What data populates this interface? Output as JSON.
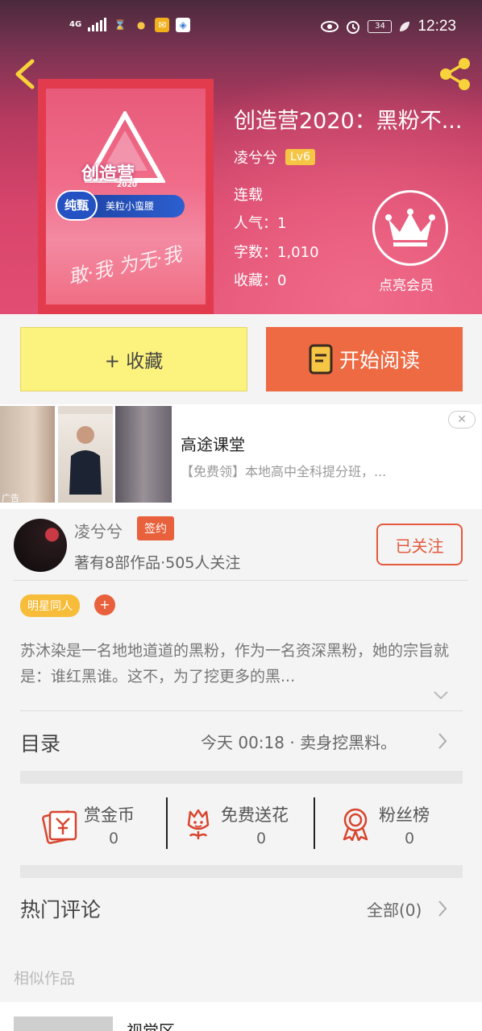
{
  "status_bar": {
    "network": "4G",
    "battery": "34",
    "time": "12:23"
  },
  "book": {
    "title": "创造营2020：黑粉不...",
    "author": "凌兮兮",
    "level": "Lv6",
    "status": "连载",
    "popularity": "人气：1",
    "word_count": "字数：1,010",
    "favorites": "收藏：0",
    "vip_label": "点亮会员",
    "cover": {
      "logo_text": "创造营",
      "logo_year": "2020",
      "sponsor_pill": "纯甄",
      "sponsor_band": "美粒小蛮腰",
      "slogan": "敢·我 为无·我"
    }
  },
  "actions": {
    "favorite_label": "+ 收藏",
    "read_label": "开始阅读"
  },
  "ad": {
    "tag": "广告",
    "title": "高途课堂",
    "description": "【免费领】本地高中全科提分班，...",
    "close_symbol": "✕"
  },
  "author_card": {
    "name": "凌兮兮",
    "badge": "签约",
    "stats": "著有8部作品·505人关注",
    "follow_label": "已关注"
  },
  "tags": {
    "genre": "明星同人",
    "add": "+"
  },
  "synopsis": "苏沐染是一名地地道道的黑粉，作为一名资深黑粉，她的宗旨就是：谁红黑谁。这不，为了挖更多的黑...",
  "catalog": {
    "title": "目录",
    "latest": "今天 00:18 · 卖身挖黑料。"
  },
  "rewards": [
    {
      "label": "赏金币",
      "value": "0",
      "icon": "gold-coin-icon"
    },
    {
      "label": "免费送花",
      "value": "0",
      "icon": "flower-icon"
    },
    {
      "label": "粉丝榜",
      "value": "0",
      "icon": "medal-icon"
    }
  ],
  "comments": {
    "title": "热门评论",
    "all_label": "全部(0)"
  },
  "similar": {
    "section_label": "相似作品",
    "first_title": "视觉区"
  },
  "colors": {
    "accent": "#ed6a43",
    "favorite_bg": "#fcf27e",
    "level_badge": "#f6c544",
    "tag_bg": "#f7bc39",
    "hero_gradient_top": "#4a2a3c",
    "hero_gradient_bottom": "#e24e73"
  }
}
